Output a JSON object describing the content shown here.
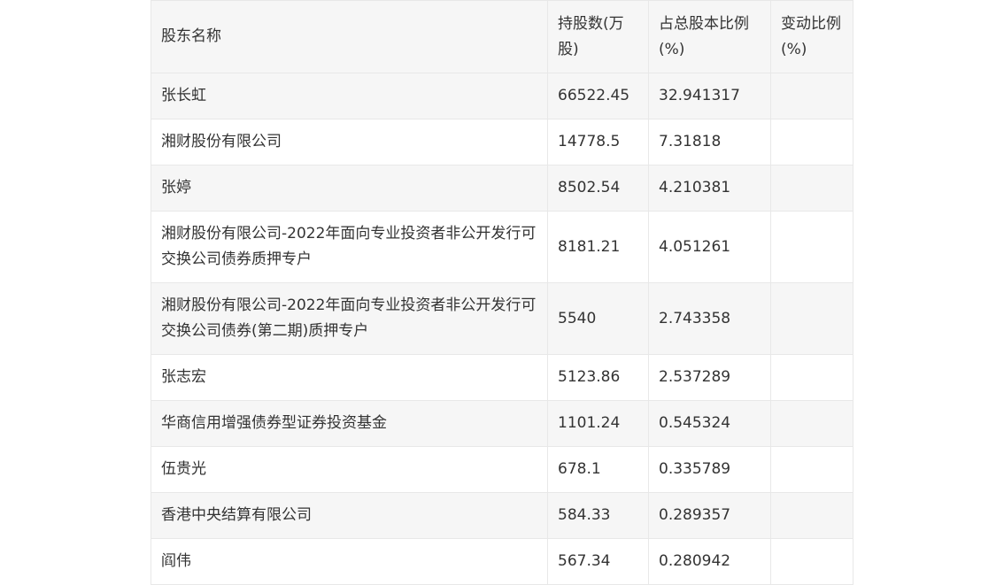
{
  "table": {
    "headers": [
      "股东名称",
      "持股数(万股)",
      "占总股本比例(%)",
      "变动比例(%)"
    ],
    "rows": [
      {
        "name": "张长虹",
        "shares": "66522.45",
        "ratio": "32.941317",
        "change": ""
      },
      {
        "name": "湘财股份有限公司",
        "shares": "14778.5",
        "ratio": "7.31818",
        "change": ""
      },
      {
        "name": "张婷",
        "shares": "8502.54",
        "ratio": "4.210381",
        "change": ""
      },
      {
        "name": "湘财股份有限公司-2022年面向专业投资者非公开发行可交换公司债券质押专户",
        "shares": "8181.21",
        "ratio": "4.051261",
        "change": ""
      },
      {
        "name": "湘财股份有限公司-2022年面向专业投资者非公开发行可交换公司债券(第二期)质押专户",
        "shares": "5540",
        "ratio": "2.743358",
        "change": ""
      },
      {
        "name": "张志宏",
        "shares": "5123.86",
        "ratio": "2.537289",
        "change": ""
      },
      {
        "name": "华商信用增强债券型证券投资基金",
        "shares": "1101.24",
        "ratio": "0.545324",
        "change": ""
      },
      {
        "name": "伍贵光",
        "shares": "678.1",
        "ratio": "0.335789",
        "change": ""
      },
      {
        "name": "香港中央结算有限公司",
        "shares": "584.33",
        "ratio": "0.289357",
        "change": ""
      },
      {
        "name": "阎伟",
        "shares": "567.34",
        "ratio": "0.280942",
        "change": ""
      }
    ]
  }
}
